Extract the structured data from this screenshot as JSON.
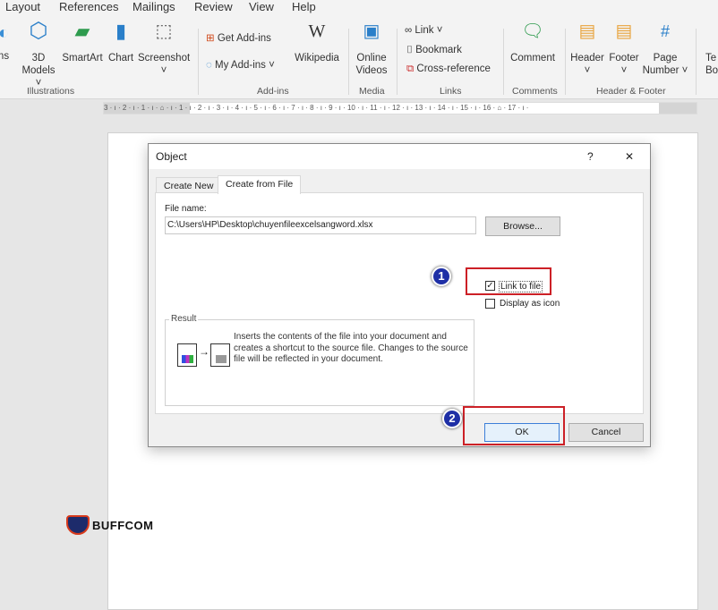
{
  "menu": [
    "Layout",
    "References",
    "Mailings",
    "Review",
    "View",
    "Help"
  ],
  "ribbon": {
    "illustrations": {
      "label": "Illustrations",
      "items": [
        "ns",
        "3D Models",
        "SmartArt",
        "Chart",
        "Screenshot"
      ]
    },
    "addins": {
      "label": "Add-ins",
      "get": "Get Add-ins",
      "my": "My Add-ins",
      "wiki": "Wikipedia"
    },
    "media": {
      "label": "Media",
      "video": "Online Videos"
    },
    "links": {
      "label": "Links",
      "link": "Link",
      "bookmark": "Bookmark",
      "xref": "Cross-reference"
    },
    "comments": {
      "label": "Comments",
      "comment": "Comment"
    },
    "hf": {
      "label": "Header & Footer",
      "header": "Header",
      "footer": "Footer",
      "page": "Page Number"
    },
    "text": {
      "partial": "Te Bo"
    }
  },
  "ruler": "3 · ı · 2 · ı · 1 · ı · ⌂ · ı · 1 · ı · 2 · ı · 3 · ı · 4 · ı · 5 · ı · 6 · ı · 7 · ı · 8 · ı · 9 · ı · 10 · ı · 11 · ı · 12 · ı · 13 · ı · 14 · ı · 15 · ı · 16 · ⌂ · 17 · ı ·",
  "dialog": {
    "title": "Object",
    "help": "?",
    "close": "✕",
    "tabs": [
      "Create New",
      "Create from File"
    ],
    "file_label": "File name:",
    "file_value": "C:\\Users\\HP\\Desktop\\chuyenfileexcelsangword.xlsx",
    "browse": "Browse...",
    "link_to_file": "Link to file",
    "link_checked": true,
    "display_as_icon": "Display as icon",
    "icon_checked": false,
    "result_label": "Result",
    "result_text": "Inserts the contents of the file into your document and creates a shortcut to the source file.  Changes to the source file will be reflected in your document.",
    "ok": "OK",
    "cancel": "Cancel"
  },
  "annotations": {
    "step1": "1",
    "step2": "2",
    "color": "#cc2026",
    "badge_color": "#1e2fa6"
  },
  "watermark": "BUFFCOM"
}
